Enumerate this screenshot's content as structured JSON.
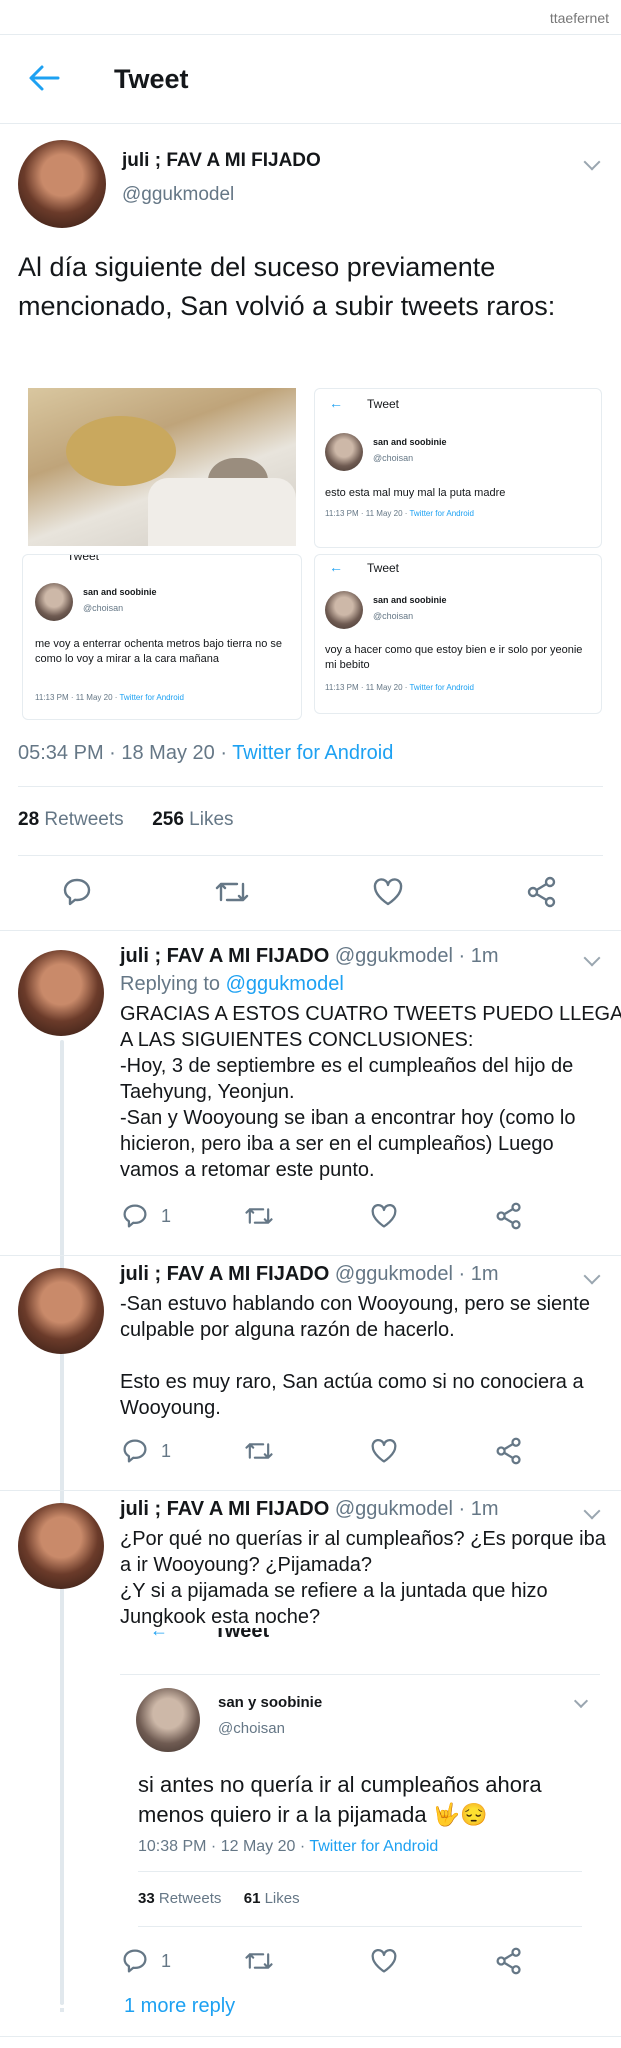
{
  "watermark": "ttaefernet",
  "header": {
    "title": "Tweet"
  },
  "main_tweet": {
    "name": "juli ; FAV A MI FIJADO",
    "handle": "@ggukmodel",
    "text": "Al día siguiente del suceso previamente mencionado, San volvió a subir tweets raros:",
    "time": "05:34 PM · 18 May 20 · ",
    "source": "Twitter for Android",
    "retweets_count": "28",
    "retweets_label": "Retweets",
    "likes_count": "256",
    "likes_label": "Likes",
    "media": {
      "tile2": {
        "header": "Tweet",
        "name": "san and soobinie",
        "handle": "@choisan",
        "text": "esto esta mal muy mal la puta madre",
        "time": "11:13 PM · 11 May 20 · ",
        "source": "Twitter for Android"
      },
      "tile3": {
        "header": "Tweet",
        "name": "san and soobinie",
        "handle": "@choisan",
        "text": "me voy a enterrar ochenta metros bajo tierra no se como lo voy a mirar a la cara mañana",
        "time": "11:13 PM · 11 May 20 · ",
        "source": "Twitter for Android"
      },
      "tile4": {
        "header": "Tweet",
        "name": "san and soobinie",
        "handle": "@choisan",
        "text": "voy a hacer como que estoy bien e ir solo por yeonie mi bebito",
        "time": "11:13 PM · 11 May 20 · ",
        "source": "Twitter for Android"
      }
    }
  },
  "replies": [
    {
      "name": "juli ; FAV A MI FIJADO",
      "handle": "@ggukmodel",
      "time": "· 1m",
      "replying_prefix": "Replying to ",
      "replying_to": "@ggukmodel",
      "lines": [
        "GRACIAS A ESTOS CUATRO TWEETS PUEDO LLEGAR",
        "A LAS SIGUIENTES CONCLUSIONES:",
        "-Hoy, 3 de septiembre es el cumpleaños del hijo de",
        "Taehyung, Yeonjun.",
        "-San y Wooyoung se iban a encontrar hoy (como lo",
        "hicieron, pero iba a ser en el cumpleaños) Luego",
        "vamos a retomar este punto."
      ],
      "reply_count": "1"
    },
    {
      "name": "juli ; FAV A MI FIJADO",
      "handle": "@ggukmodel",
      "time": "· 1m",
      "lines": [
        "-San estuvo hablando con Wooyoung, pero se siente",
        "culpable por alguna razón de hacerlo.",
        "",
        "Esto es muy raro, San actúa como si no conociera a",
        "Wooyoung."
      ],
      "reply_count": "1"
    },
    {
      "name": "juli ; FAV A MI FIJADO",
      "handle": "@ggukmodel",
      "time": "· 1m",
      "lines": [
        "¿Por qué no querías ir al cumpleaños? ¿Es porque iba",
        "a ir Wooyoung? ¿Pijamada?",
        "¿Y si a pijamada se refiere a la juntada que hizo",
        "Jungkook esta noche?"
      ],
      "reply_count": "1",
      "embedded": {
        "header": "Tweet",
        "name": "san y soobinie",
        "handle": "@choisan",
        "text_line1": "si antes no quería ir al cumpleaños ahora",
        "text_line2": "menos quiero ir a la pijamada 🤟😔",
        "time": "10:38 PM · 12 May 20 · ",
        "source": "Twitter for Android",
        "retweets_count": "33",
        "retweets_label": "Retweets",
        "likes_count": "61",
        "likes_label": "Likes"
      }
    }
  ],
  "more_replies": "1 more reply",
  "colors": {
    "accent": "#1da1f2",
    "muted": "#657786",
    "divider": "#e6ecf0"
  }
}
